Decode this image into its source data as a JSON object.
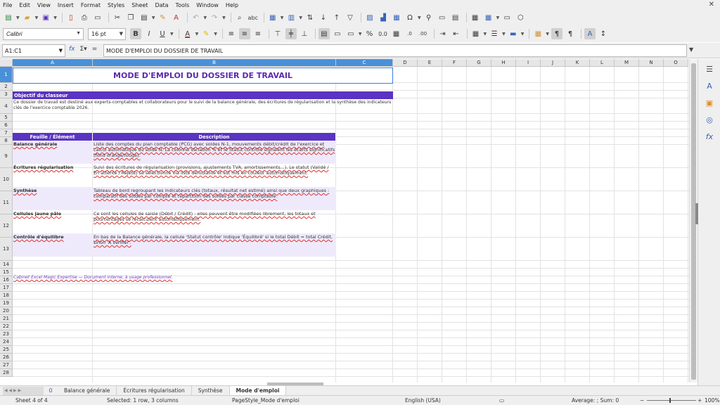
{
  "menu": [
    "File",
    "Edit",
    "View",
    "Insert",
    "Format",
    "Styles",
    "Sheet",
    "Data",
    "Tools",
    "Window",
    "Help"
  ],
  "font": {
    "name": "Calibri",
    "size": "16 pt"
  },
  "formula_bar": {
    "cell_ref": "A1:C1",
    "content": "MODE D'EMPLOI DU DOSSIER DE TRAVAIL"
  },
  "columns": [
    "A",
    "B",
    "C",
    "D",
    "E",
    "F",
    "G",
    "H",
    "I",
    "J",
    "K",
    "L",
    "M",
    "N",
    "O"
  ],
  "rows": [
    "1",
    "2",
    "3",
    "4",
    "5",
    "6",
    "7",
    "8",
    "9",
    "10",
    "11",
    "12",
    "13",
    "14",
    "15",
    "16",
    "17",
    "18",
    "19",
    "20",
    "21",
    "22",
    "23",
    "24",
    "25",
    "26",
    "27",
    "28"
  ],
  "sheet": {
    "title": "MODE D'EMPLOI DU DOSSIER DE TRAVAIL",
    "objective_header": "Objectif du classeur",
    "objective_text": "Ce dossier de travail est destiné aux experts-comptables et collaborateurs pour le suivi de la balance générale, des écritures de régularisation et la synthèse des indicateurs clés de l'exercice comptable 2026.",
    "table_headers": [
      "Feuille / Élément",
      "Description"
    ],
    "table_rows": [
      {
        "name": "Balance générale",
        "desc": "Liste des comptes du plan comptable (PCG) avec soldes N-1, mouvements débit/crédit de l'exercice et calcul automatique du solde N. La colonne Variation % et le Statut contrôle signalent les écarts significatifs (fond orange/rouge)."
      },
      {
        "name": "Écritures régularisation",
        "desc": "Suivi des écritures de régularisation (provisions, ajustements TVA, amortissements...). Le statut (Validé / En attente / Rejeté) se sélectionne via liste déroulante et est mis en couleur automatiquement."
      },
      {
        "name": "Synthèse",
        "desc": "Tableau de bord regroupant les indicateurs clés (totaux, résultat net estimé) ainsi que deux graphiques : comparatif des soldes par compte et répartition des soldes par classe comptable."
      },
      {
        "name": "Cellules jaune pâle",
        "desc": "Ce sont les cellules de saisie (Débit / Crédit) : elles peuvent être modifiées librement, les totaux et pourcentages se recalculent automatiquement."
      },
      {
        "name": "Contrôle d'équilibre",
        "desc": "En bas de la Balance générale, la cellule 'Statut contrôle' indique 'Équilibré' si le total Débit = total Crédit, sinon 'À vérifier'."
      }
    ],
    "footnote": "Cabinet Excel Magic Expertise — Document interne, à usage professionnel."
  },
  "tabs": {
    "add": "0",
    "items": [
      "Balance générale",
      "Écritures régularisation",
      "Synthèse",
      "Mode d'emploi"
    ],
    "active_index": 3
  },
  "status": {
    "sheet": "Sheet 4 of 4",
    "selection": "Selected: 1 row, 3 columns",
    "page_style": "PageStyle_Mode d'emploi",
    "language": "English (USA)",
    "summary": "Average: ; Sum: 0",
    "zoom": "100%"
  },
  "colors": {
    "accent_purple": "#5a34c2",
    "lavender": "#efeafb",
    "selection_blue": "#4a90d9"
  },
  "icons": {
    "toolbar1": [
      "new-doc-icon",
      "open-folder-icon",
      "save-icon",
      "export-pdf-icon",
      "print-icon",
      "print-preview-icon",
      "cut-icon",
      "copy-icon",
      "paste-icon",
      "clone-format-icon",
      "clear-format-icon",
      "undo-icon",
      "redo-icon",
      "find-replace-icon",
      "spellcheck-icon",
      "row-icon",
      "column-icon",
      "sort-icon",
      "sort-asc-icon",
      "sort-desc-icon",
      "autofilter-icon",
      "image-icon",
      "chart-icon",
      "pivot-icon",
      "special-char-icon",
      "hyperlink-icon",
      "comment-icon",
      "header-footer-icon",
      "define-print-area-icon",
      "freeze-icon",
      "split-window-icon",
      "shapes-icon"
    ],
    "sidebar": [
      "properties-icon",
      "styles-icon",
      "gallery-icon",
      "navigator-icon",
      "functions-icon"
    ]
  }
}
